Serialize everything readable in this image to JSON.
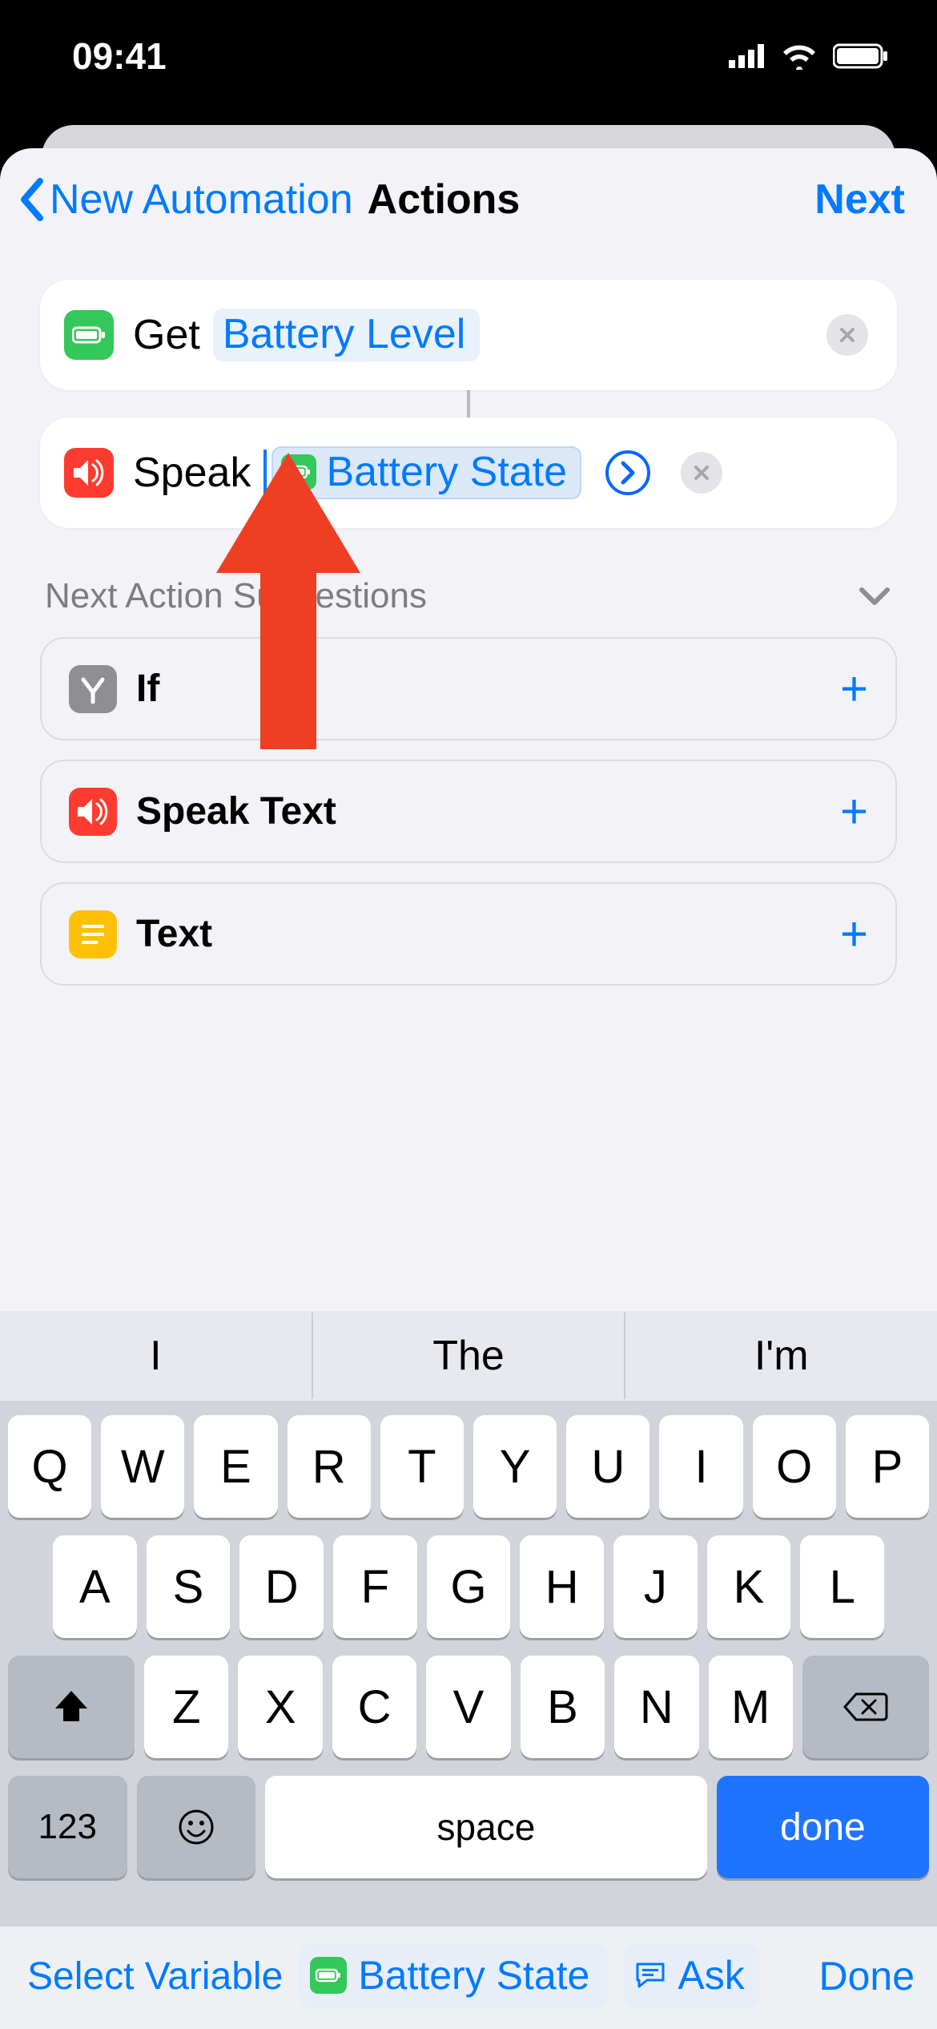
{
  "status": {
    "time": "09:41"
  },
  "nav": {
    "back_label": "New Automation",
    "title": "Actions",
    "next_label": "Next"
  },
  "actions": [
    {
      "icon": "battery-icon",
      "verb": "Get",
      "token_label": "Battery Level",
      "has_expand": false
    },
    {
      "icon": "speaker-icon",
      "verb": "Speak",
      "token_label": "Battery State",
      "has_expand": true,
      "editing": true
    }
  ],
  "suggestions": {
    "header_label": "Next Action Suggestions",
    "items": [
      {
        "icon": "branch-icon",
        "label": "If"
      },
      {
        "icon": "speaker-icon",
        "label": "Speak Text"
      },
      {
        "icon": "text-icon",
        "label": "Text"
      }
    ]
  },
  "accessory": {
    "select_variable_label": "Select Variable",
    "chips": [
      {
        "icon": "battery-icon",
        "label": "Battery State",
        "kind": "variable"
      },
      {
        "icon": "message-icon",
        "label": "Ask",
        "kind": "ask"
      }
    ],
    "done_label": "Done"
  },
  "keyboard": {
    "predictions": [
      "I",
      "The",
      "I'm"
    ],
    "rows": [
      [
        "Q",
        "W",
        "E",
        "R",
        "T",
        "Y",
        "U",
        "I",
        "O",
        "P"
      ],
      [
        "A",
        "S",
        "D",
        "F",
        "G",
        "H",
        "J",
        "K",
        "L"
      ],
      [
        "Z",
        "X",
        "C",
        "V",
        "B",
        "N",
        "M"
      ]
    ],
    "numbers_label": "123",
    "space_label": "space",
    "done_label": "done"
  }
}
